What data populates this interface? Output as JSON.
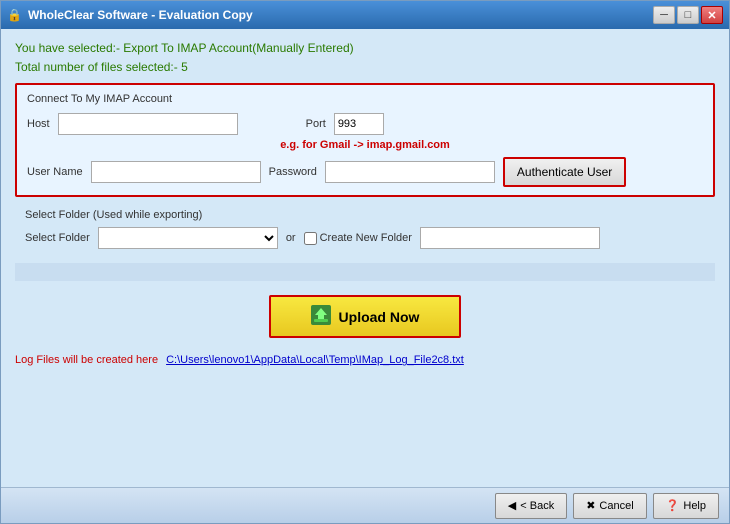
{
  "window": {
    "title": "WholeClear Software - Evaluation Copy"
  },
  "header": {
    "selection_line1": "You have selected:- Export To IMAP Account(Manually Entered)",
    "selection_line2": "Total number of files selected:- 5"
  },
  "imap_section": {
    "title": "Connect To My IMAP Account",
    "host_label": "Host",
    "port_label": "Port",
    "port_value": "993",
    "gmail_hint": "e.g. for Gmail -> imap.gmail.com",
    "username_label": "User Name",
    "password_label": "Password",
    "host_placeholder": "",
    "username_placeholder": "",
    "password_placeholder": "",
    "auth_button_label": "Authenticate User"
  },
  "folder_section": {
    "title": "Select Folder (Used while exporting)",
    "select_label": "Select Folder",
    "or_text": "or",
    "create_new_label": "Create New Folder",
    "new_folder_placeholder": ""
  },
  "upload": {
    "button_label": "Upload Now"
  },
  "log": {
    "label": "Log Files will be created here",
    "link_text": "C:\\Users\\lenovo1\\AppData\\Local\\Temp\\IMap_Log_File2c8.txt"
  },
  "bottom_nav": {
    "back_label": "< Back",
    "cancel_label": "Cancel",
    "help_label": "Help"
  },
  "icons": {
    "title_icon": "🔒",
    "back_icon": "◀",
    "cancel_icon": "✖",
    "help_icon": "❓",
    "upload_icon": "⬆"
  }
}
